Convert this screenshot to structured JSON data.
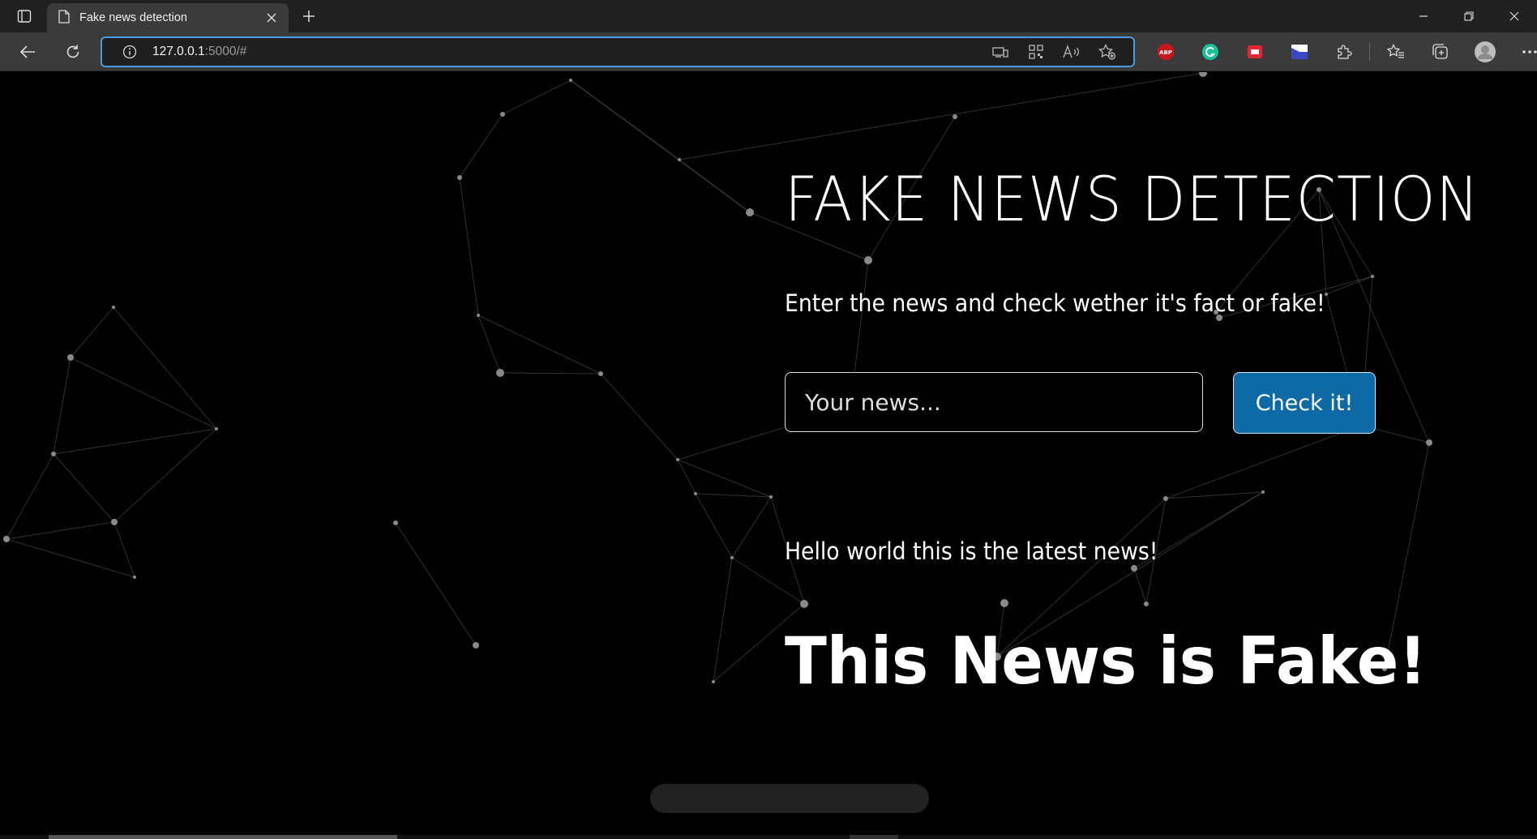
{
  "browser": {
    "tab": {
      "title": "Fake news detection"
    },
    "address": {
      "host": "127.0.0.1",
      "rest": ":5000/#"
    }
  },
  "page": {
    "title": "FAKE NEWS DETECTION",
    "subtitle": "Enter the news and check wether it's fact or fake!",
    "input": {
      "placeholder": "Your news..."
    },
    "button_label": "Check it!",
    "latest_news": "Hello world this is the latest news!",
    "verdict": "This News is Fake!"
  },
  "colors": {
    "page_background": "#000000",
    "button_background": "#0e6aa4",
    "address_focus_border": "#4a9be0"
  }
}
